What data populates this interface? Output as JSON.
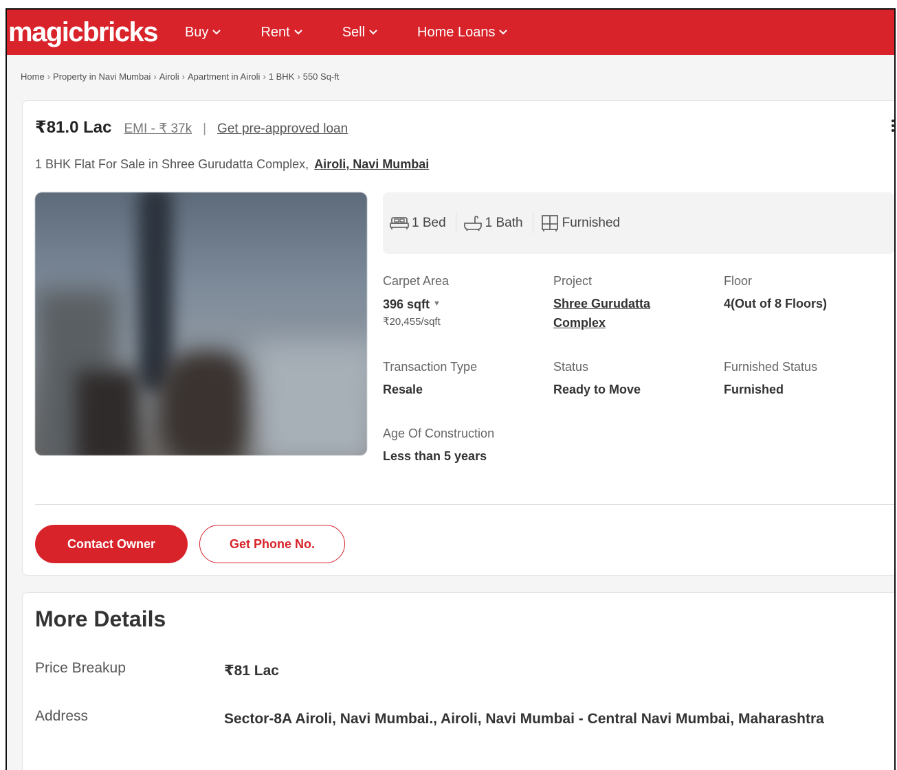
{
  "header": {
    "logo": "magicbricks",
    "nav": [
      {
        "label": "Buy"
      },
      {
        "label": "Rent"
      },
      {
        "label": "Sell"
      },
      {
        "label": "Home Loans"
      }
    ],
    "brand_color": "#d8232a"
  },
  "breadcrumb": [
    "Home",
    "Property in Navi Mumbai",
    "Airoli",
    "Apartment in Airoli",
    "1 BHK",
    "550 Sq-ft"
  ],
  "listing": {
    "price": "₹81.0 Lac",
    "emi": "EMI - ₹ 37k",
    "separator": "|",
    "loan_link": "Get pre-approved loan",
    "title": "1 BHK Flat For Sale in Shree Gurudatta Complex,",
    "location": "Airoli, Navi Mumbai",
    "amenities": [
      {
        "icon": "bed-icon",
        "label": "1 Bed"
      },
      {
        "icon": "bath-icon",
        "label": "1 Bath"
      },
      {
        "icon": "furnished-icon",
        "label": "Furnished"
      }
    ],
    "facts": {
      "carpet_area": {
        "label": "Carpet Area",
        "value": "396 sqft",
        "sub": "₹20,455/sqft"
      },
      "project": {
        "label": "Project",
        "value": "Shree Gurudatta Complex"
      },
      "floor": {
        "label": "Floor",
        "value": "4(Out of 8 Floors)"
      },
      "transaction": {
        "label": "Transaction Type",
        "value": "Resale"
      },
      "status": {
        "label": "Status",
        "value": "Ready to Move"
      },
      "furnished_status": {
        "label": "Furnished Status",
        "value": "Furnished"
      },
      "age": {
        "label": "Age Of Construction",
        "value": "Less than 5 years"
      }
    },
    "buttons": {
      "contact": "Contact Owner",
      "phone": "Get Phone No."
    }
  },
  "more_details": {
    "title": "More Details",
    "rows": [
      {
        "key": "Price Breakup",
        "value": "₹81 Lac"
      },
      {
        "key": "Address",
        "value": "Sector-8A Airoli, Navi Mumbai., Airoli, Navi Mumbai - Central Navi Mumbai, Maharashtra"
      }
    ]
  }
}
